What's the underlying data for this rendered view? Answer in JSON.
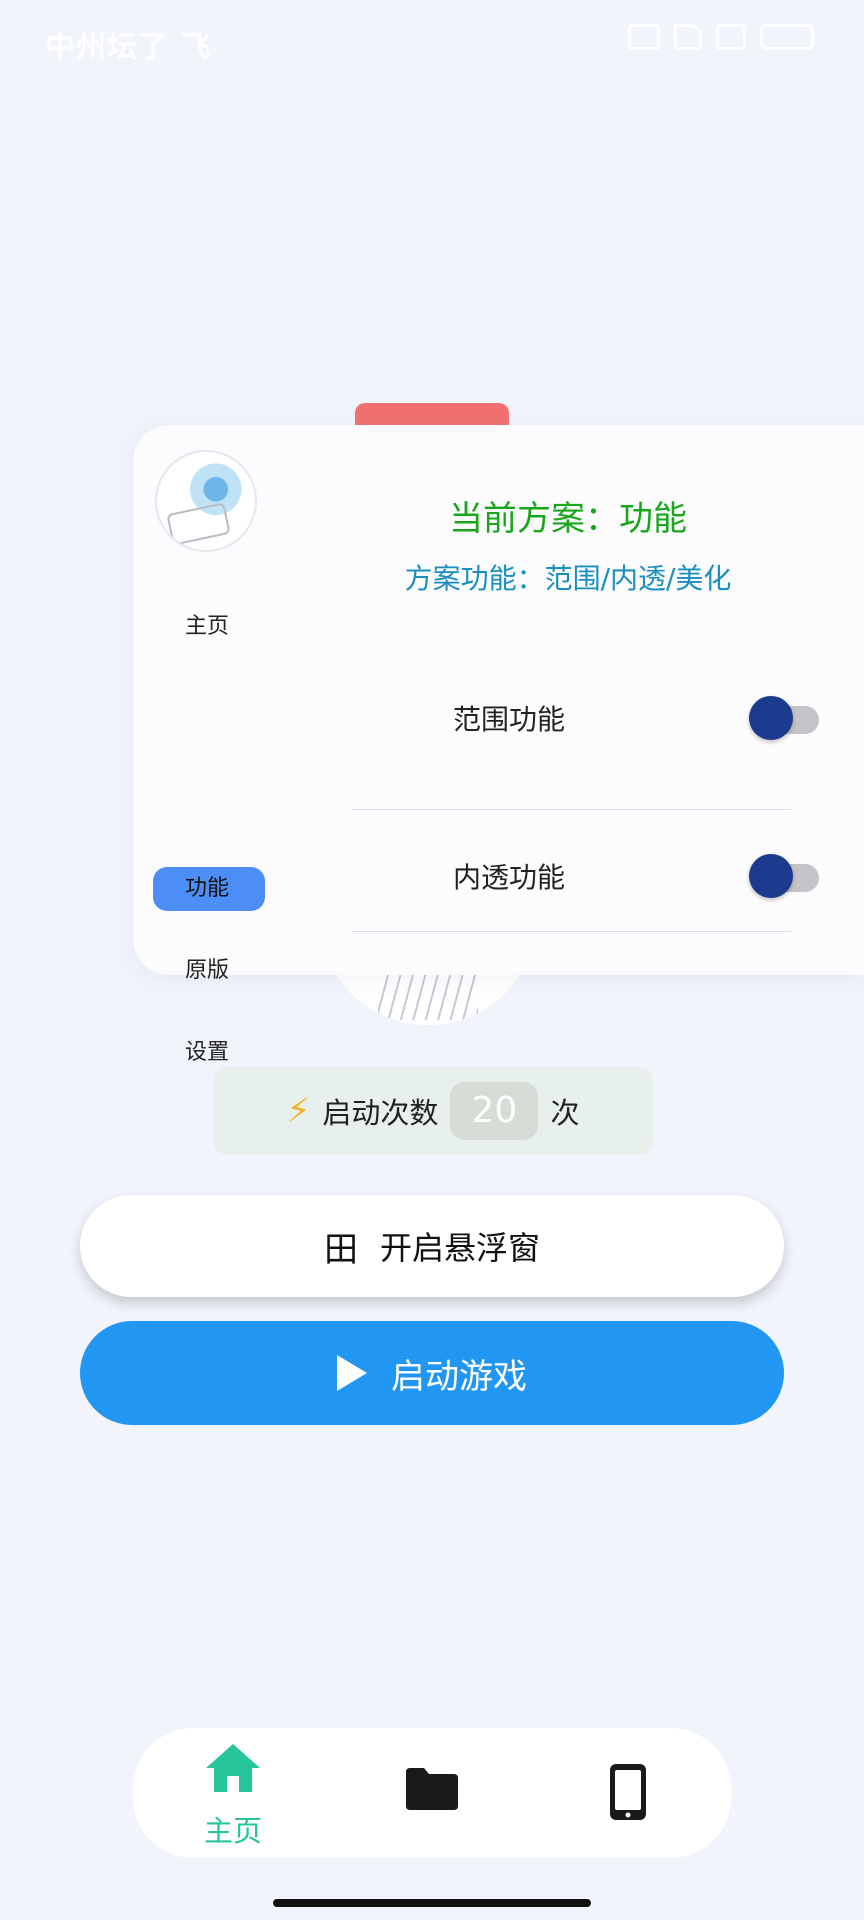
{
  "status_bar": {
    "left_text": "中州坛了 飞"
  },
  "menu": {
    "nav_items": [
      {
        "label": "主页",
        "active": false
      },
      {
        "label": "功能",
        "active": true
      },
      {
        "label": "原版",
        "active": false
      },
      {
        "label": "设置",
        "active": false
      }
    ],
    "scheme_title": "当前方案：功能",
    "scheme_subtitle": "方案功能：范围/内透/美化",
    "features": [
      {
        "label": "范围功能",
        "enabled": false
      },
      {
        "label": "内透功能",
        "enabled": false
      }
    ]
  },
  "launch": {
    "label": "启动次数",
    "count": "20",
    "unit": "次"
  },
  "buttons": {
    "float_window": "开启悬浮窗",
    "float_icon": "田",
    "start_game": "启动游戏"
  },
  "bottom_nav": {
    "home_label": "主页",
    "active_color": "#27c59a"
  },
  "colors": {
    "accent_blue": "#2196f3",
    "scheme_green": "#1aa61a",
    "scheme_blue": "#1a8fbf",
    "nav_active": "#4d8df6",
    "toggle_knob": "#1c3b8e"
  }
}
